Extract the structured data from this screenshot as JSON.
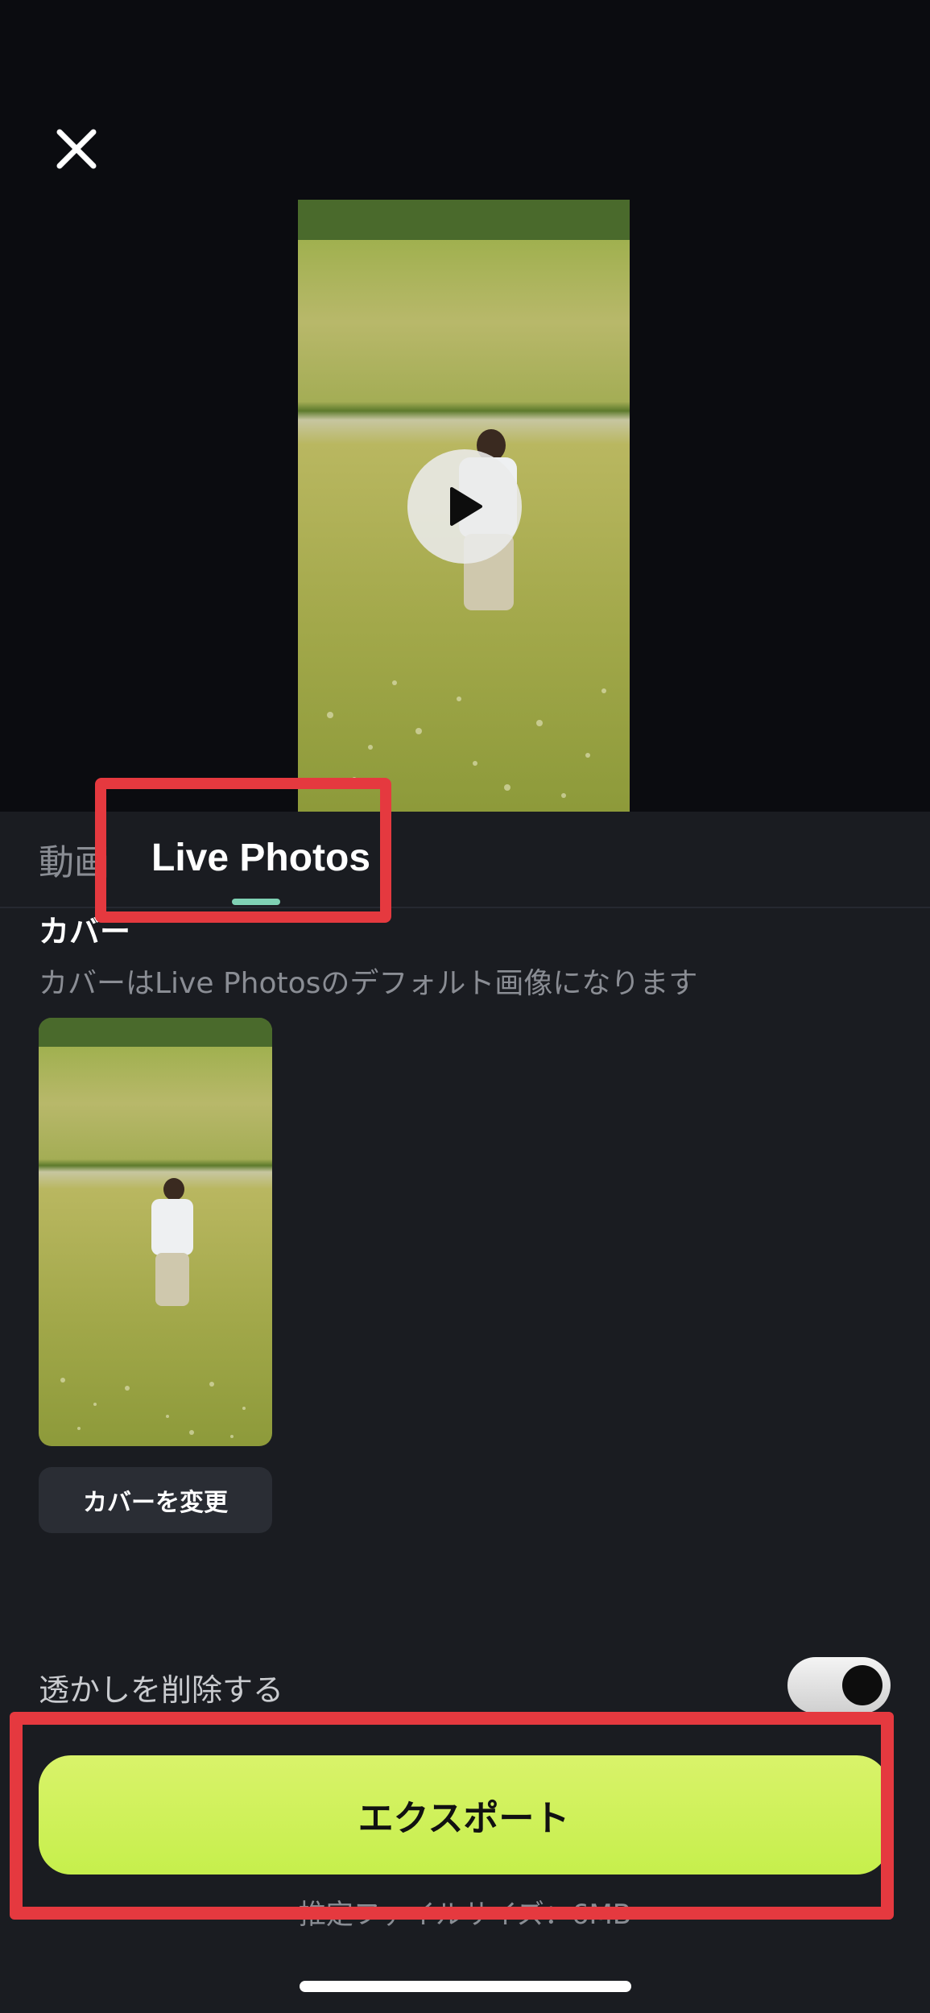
{
  "header": {
    "close_icon": "close-icon"
  },
  "preview": {
    "play_icon": "play-icon"
  },
  "tabs": [
    {
      "label": "動画"
    },
    {
      "label": "Live Photos",
      "selected": true
    }
  ],
  "cover": {
    "title": "カバー",
    "description": "カバーはLive Photosのデフォルト画像になります",
    "change_button": "カバーを変更"
  },
  "settings": {
    "watermark_label": "透かしを削除する",
    "watermark_enabled": true
  },
  "export": {
    "button_label": "エクスポート",
    "filesize_text": "推定ファイルサイズ：6MB"
  },
  "colors": {
    "accent": "#c6ef4c",
    "tab_underline": "#7fd1b4",
    "annotation": "#e5393f",
    "panel_bg": "#1a1c21",
    "top_bg": "#0b0c10"
  }
}
